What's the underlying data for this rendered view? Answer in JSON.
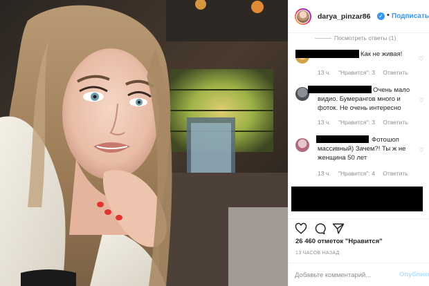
{
  "post": {
    "username": "darya_pinzar86",
    "follow_label": "Подписаться",
    "separator": "•",
    "verified_glyph": "✓"
  },
  "comments": {
    "view_replies": "Посмотреть ответы (1)",
    "items": [
      {
        "text": "Как не живая!",
        "time": "13 ч.",
        "likes": "\"Нравится\": 3",
        "reply": "Ответить"
      },
      {
        "text_line1": "Очень мало",
        "text_rest": "видио. Бумерангов много и фоток. Не очень интересно",
        "time": "13 ч.",
        "likes": "\"Нравится\": 3",
        "reply": "Ответить"
      },
      {
        "text_line1": "Фотошоп",
        "text_rest": "массивный) Зачем?! Ты ж не женщина 50 лет",
        "time": "13 ч.",
        "likes": "\"Нравится\": 4",
        "reply": "Ответить"
      }
    ]
  },
  "actions": {
    "icons": [
      "heart-icon",
      "comment-icon",
      "share-icon"
    ]
  },
  "likes_text": "26 460 отметок \"Нравится\"",
  "timestamp": "13 ЧАСОВ НАЗАД",
  "add_comment": {
    "placeholder": "Добавьте комментарий...",
    "post_label": "Опубликовать"
  },
  "colors": {
    "accent": "#3897f0",
    "muted": "#8e8e8e",
    "text": "#262626"
  }
}
